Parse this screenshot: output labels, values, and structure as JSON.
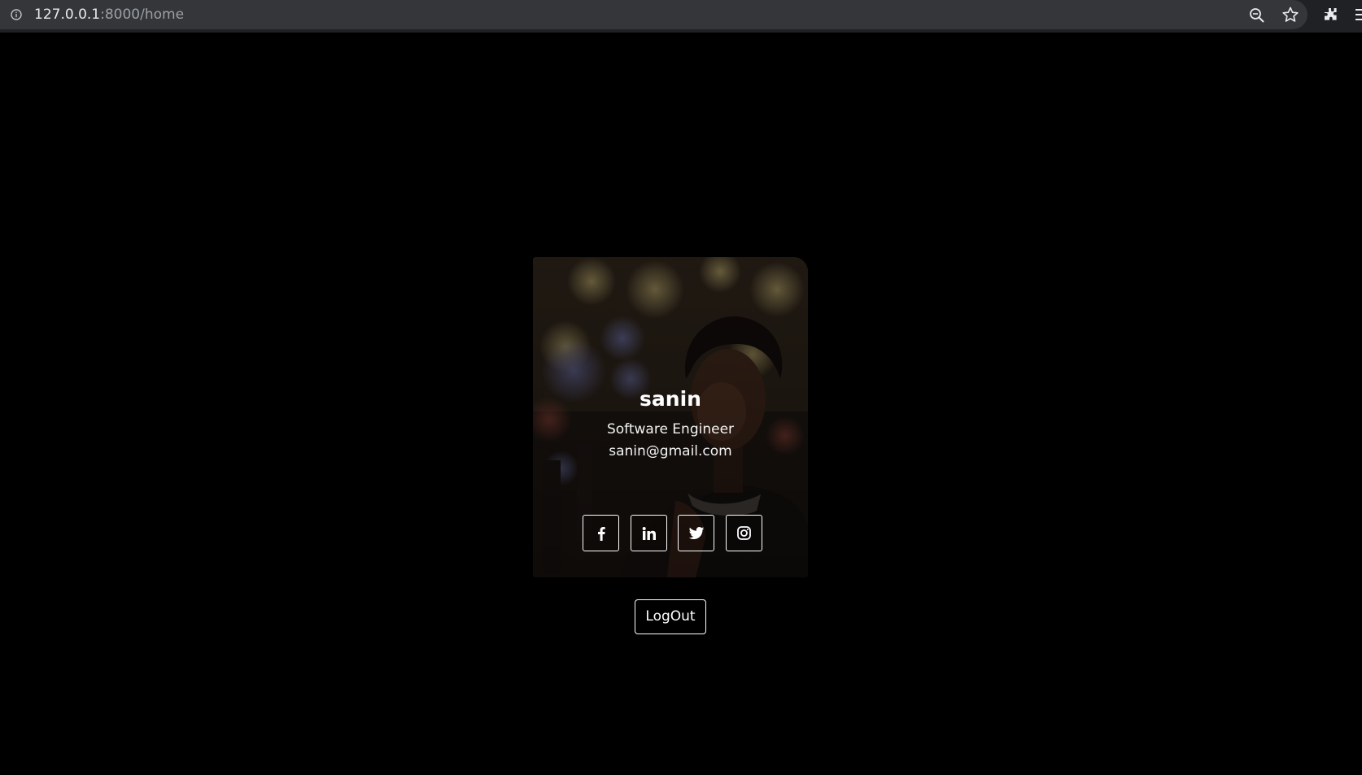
{
  "browser": {
    "url_host": "127.0.0.1",
    "url_path": ":8000/home",
    "icons": [
      "info-icon",
      "zoom-icon",
      "star-icon",
      "extensions-icon",
      "menu-icon"
    ]
  },
  "profile": {
    "name": "sanin",
    "role": "Software Engineer",
    "email": "sanin@gmail.com",
    "social_icons": [
      "facebook-icon",
      "linkedin-icon",
      "twitter-icon",
      "instagram-icon"
    ]
  },
  "actions": {
    "logout_label": "LogOut"
  },
  "colors": {
    "page_background": "#000000",
    "browser_bar": "#202124",
    "address_field": "#35363a",
    "text": "#ffffff"
  }
}
